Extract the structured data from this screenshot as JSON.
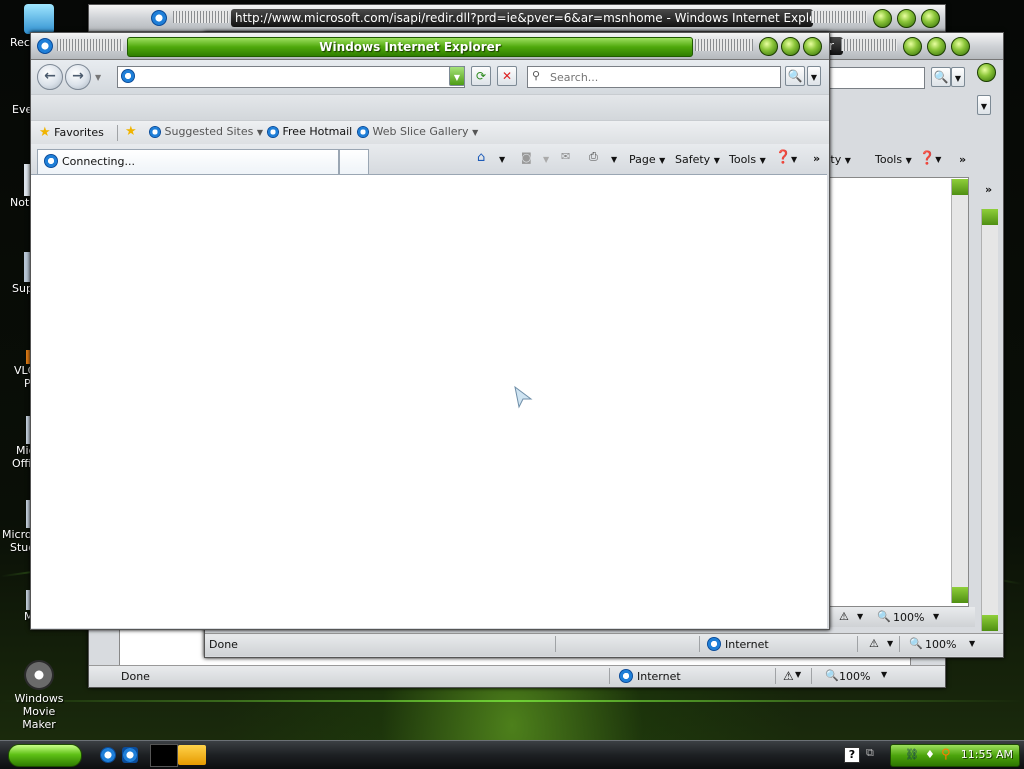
{
  "desktop": {
    "icons": [
      {
        "label": "Rec",
        "name": "recycle-bin"
      },
      {
        "label": "Eve",
        "name": "event"
      },
      {
        "label": "Note",
        "name": "notepad"
      },
      {
        "label": "Sup",
        "name": "support"
      },
      {
        "label": "VLC",
        "name": "vlc"
      },
      {
        "label": "P",
        "name": "vlc-p"
      },
      {
        "label": "Mic",
        "name": "microsoft"
      },
      {
        "label": "Offi",
        "name": "office"
      },
      {
        "label": "Micros",
        "name": "microsoft-studio"
      },
      {
        "label": "Studi",
        "name": "studio"
      },
      {
        "label": "M",
        "name": "m-app"
      },
      {
        "label": "Windows Movie",
        "name": "windows-movie"
      },
      {
        "label": "Maker",
        "name": "maker"
      }
    ]
  },
  "back_window": {
    "title": "http://www.microsoft.com/isapi/redir.dll?prd=ie&pver=6&ar=msnhome - Windows Internet Explorer",
    "status": "Done",
    "zone": "Internet",
    "zoom": "100%"
  },
  "mid_window": {
    "title_fragment": "r",
    "cmd_safety": "afety",
    "cmd_tools": "Tools",
    "chevron": "»",
    "status": "Done",
    "zone": "Internet",
    "zoom": "100%",
    "zoom2": "100%"
  },
  "front_window": {
    "title": "Windows Internet Explorer",
    "address_value": "",
    "search_placeholder": "Search...",
    "favorites_label": "Favorites",
    "fav_links": [
      "Suggested Sites",
      "Free Hotmail",
      "Web Slice Gallery"
    ],
    "tab_label": "Connecting...",
    "commands": {
      "page": "Page",
      "safety": "Safety",
      "tools": "Tools",
      "more": "»"
    }
  },
  "taskbar": {
    "clock": "11:55 AM",
    "help": "?"
  },
  "colors": {
    "accent_green": "#4fa80c",
    "taskbar_dark": "#1d2023"
  }
}
